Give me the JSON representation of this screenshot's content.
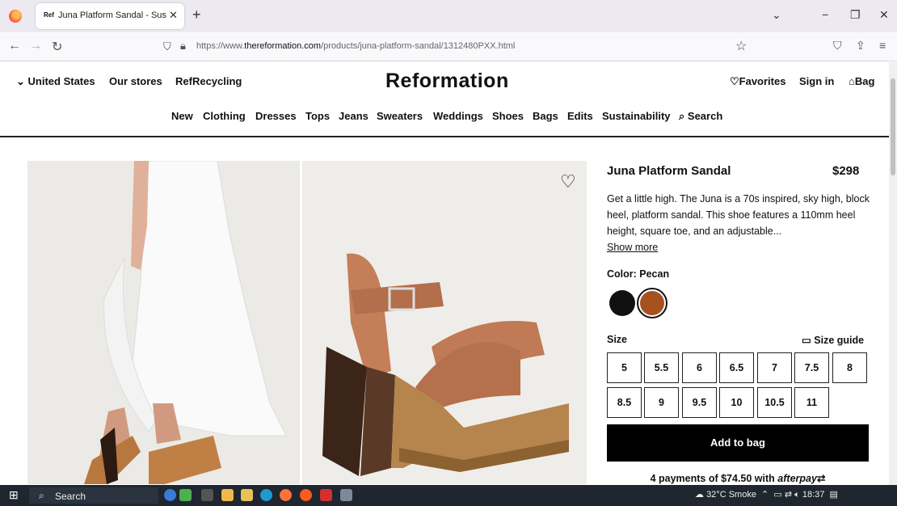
{
  "browser": {
    "tab_title": "Juna Platform Sandal - Sustaina",
    "tab_favicon_text": "Ref",
    "url_prefix": "https://www.",
    "url_domain": "thereformation.com",
    "url_path": "/products/juna-platform-sandal/1312480PXX.html"
  },
  "header": {
    "region": "United States",
    "stores": "Our stores",
    "recycling": "RefRecycling",
    "logo": "Reformation",
    "favorites": "Favorites",
    "sign_in": "Sign in",
    "bag": "Bag"
  },
  "categories": [
    "New",
    "Clothing",
    "Dresses",
    "Tops",
    "Jeans",
    "Sweaters",
    "Weddings",
    "Shoes",
    "Bags",
    "Edits",
    "Sustainability",
    "Search"
  ],
  "product": {
    "name": "Juna Platform Sandal",
    "price": "$298",
    "description": "Get a little high. The Juna is a 70s inspired, sky high, block heel, platform sandal. This shoe features a 110mm heel height, square toe, and an adjustable...",
    "show_more": "Show more",
    "color_label": "Color: Pecan",
    "colors": [
      {
        "name": "black",
        "hex": "#111111"
      },
      {
        "name": "pecan",
        "hex": "#a5521f"
      }
    ],
    "size_label": "Size",
    "size_guide": "Size guide",
    "sizes": [
      "5",
      "5.5",
      "6",
      "6.5",
      "7",
      "7.5",
      "8",
      "8.5",
      "9",
      "9.5",
      "10",
      "10.5",
      "11"
    ],
    "add_to_bag": "Add to bag",
    "payments": "4 payments of $74.50 with",
    "afterpay": "afterpay"
  },
  "taskbar": {
    "search": "Search",
    "weather": "32°C Smoke",
    "time": "18:37"
  }
}
